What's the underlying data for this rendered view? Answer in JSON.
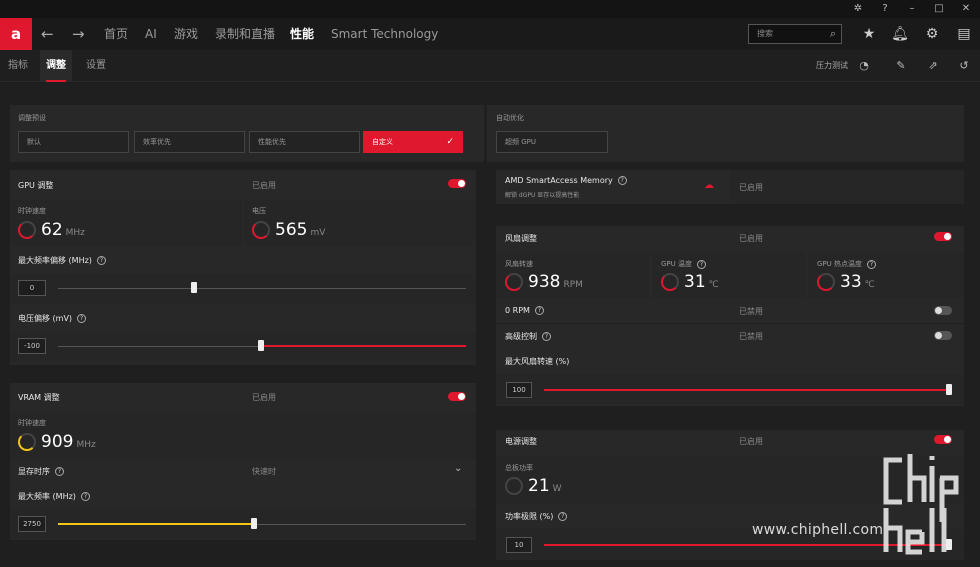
{
  "titlebar": {
    "controls": [
      "bug-icon",
      "help-icon",
      "minimize-icon",
      "maximize-icon",
      "close-icon"
    ]
  },
  "nav": {
    "logo": "a",
    "tabs": [
      "首页",
      "AI",
      "游戏",
      "录制和直播",
      "性能",
      "Smart Technology"
    ],
    "active_tab": "性能",
    "search_placeholder": "搜索"
  },
  "subnav": {
    "tabs": [
      "指标",
      "调整",
      "设置"
    ],
    "active_tab": "调整",
    "stress_test": "压力测试"
  },
  "presets": {
    "label": "调整预设",
    "options": [
      "默认",
      "效率优先",
      "性能优先",
      "自定义"
    ],
    "selected": "自定义"
  },
  "auto": {
    "label": "自动优化",
    "button": "超频 GPU"
  },
  "gpu": {
    "title": "GPU 调整",
    "state": "已启用",
    "clock_label": "时钟速度",
    "clock_value": "62",
    "clock_unit": "MHz",
    "voltage_label": "电压",
    "voltage_value": "565",
    "voltage_unit": "mV",
    "freq_offset_label": "最大频率偏移 (MHz)",
    "freq_offset_value": "0",
    "freq_offset_level": 0.45,
    "volt_offset_label": "电压偏移 (mV)",
    "volt_offset_value": "-100",
    "volt_offset_level": 0.5
  },
  "vram": {
    "title": "VRAM 调整",
    "state": "已启用",
    "clock_label": "时钟速度",
    "clock_value": "909",
    "clock_unit": "MHz",
    "timing_label": "显存时序",
    "timing_value": "快速时",
    "max_freq_label": "最大频率 (MHz)",
    "max_freq_value": "2750",
    "max_freq_level": 0.48
  },
  "sam": {
    "title": "AMD SmartAccess Memory",
    "subtitle": "解锁 dGPU 显存以提高性能",
    "state": "已启用"
  },
  "fan": {
    "title": "风扇调整",
    "state": "已启用",
    "speed_label": "风扇转速",
    "speed_value": "938",
    "speed_unit": "RPM",
    "gpu_temp_label": "GPU 温度",
    "gpu_temp_value": "31",
    "gpu_temp_unit": "℃",
    "hotspot_label": "GPU 热点温度",
    "hotspot_value": "33",
    "hotspot_unit": "℃",
    "zero_rpm_label": "0 RPM",
    "zero_rpm_state": "已禁用",
    "advanced_label": "高级控制",
    "advanced_state": "已禁用",
    "max_speed_label": "最大风扇转速 (%)",
    "max_speed_value": "100",
    "max_speed_level": 1.0
  },
  "power": {
    "title": "电源调整",
    "state": "已启用",
    "board_power_label": "总板功率",
    "board_power_value": "21",
    "board_power_unit": "W",
    "limit_label": "功率极限 (%)",
    "limit_value": "10",
    "limit_level": 1.0
  },
  "colors": {
    "accent": "#e0182d",
    "vram_accent": "#f5c518"
  },
  "watermark": {
    "text": "www.chiphell.com",
    "logo_text": "chip hell"
  }
}
